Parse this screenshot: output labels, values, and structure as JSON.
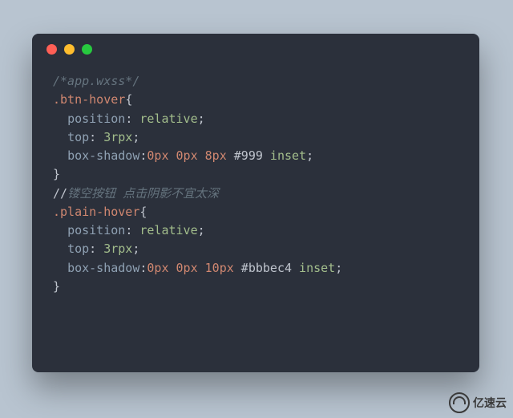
{
  "code": {
    "line1": "/*app.wxss*/",
    "line2_sel": ".btn-hover",
    "line2_brace": "{",
    "line3_prop": "position",
    "line3_val": " relative",
    "line4_prop": "top",
    "line4_val": " 3rpx",
    "line5_prop": "box-shadow",
    "line5_v1": "0px",
    "line5_v2": " 0px",
    "line5_v3": " 8px",
    "line5_v4": " #999",
    "line5_v5": " inset",
    "line6": "}",
    "line7_slashes": "//",
    "line7_txt": "镂空按钮 点击阴影不宜太深",
    "line8_sel": ".plain-hover",
    "line8_brace": "{",
    "line9_prop": "position",
    "line9_val": " relative",
    "line10_prop": "top",
    "line10_val": " 3rpx",
    "line11_prop": "box-shadow",
    "line11_v1": "0px",
    "line11_v2": " 0px",
    "line11_v3": " 10px",
    "line11_v4": " #bbbec4",
    "line11_v5": " inset",
    "line12": "}",
    "indent": "  ",
    "colon": ":",
    "semi": ";"
  },
  "logo_text": "亿速云"
}
